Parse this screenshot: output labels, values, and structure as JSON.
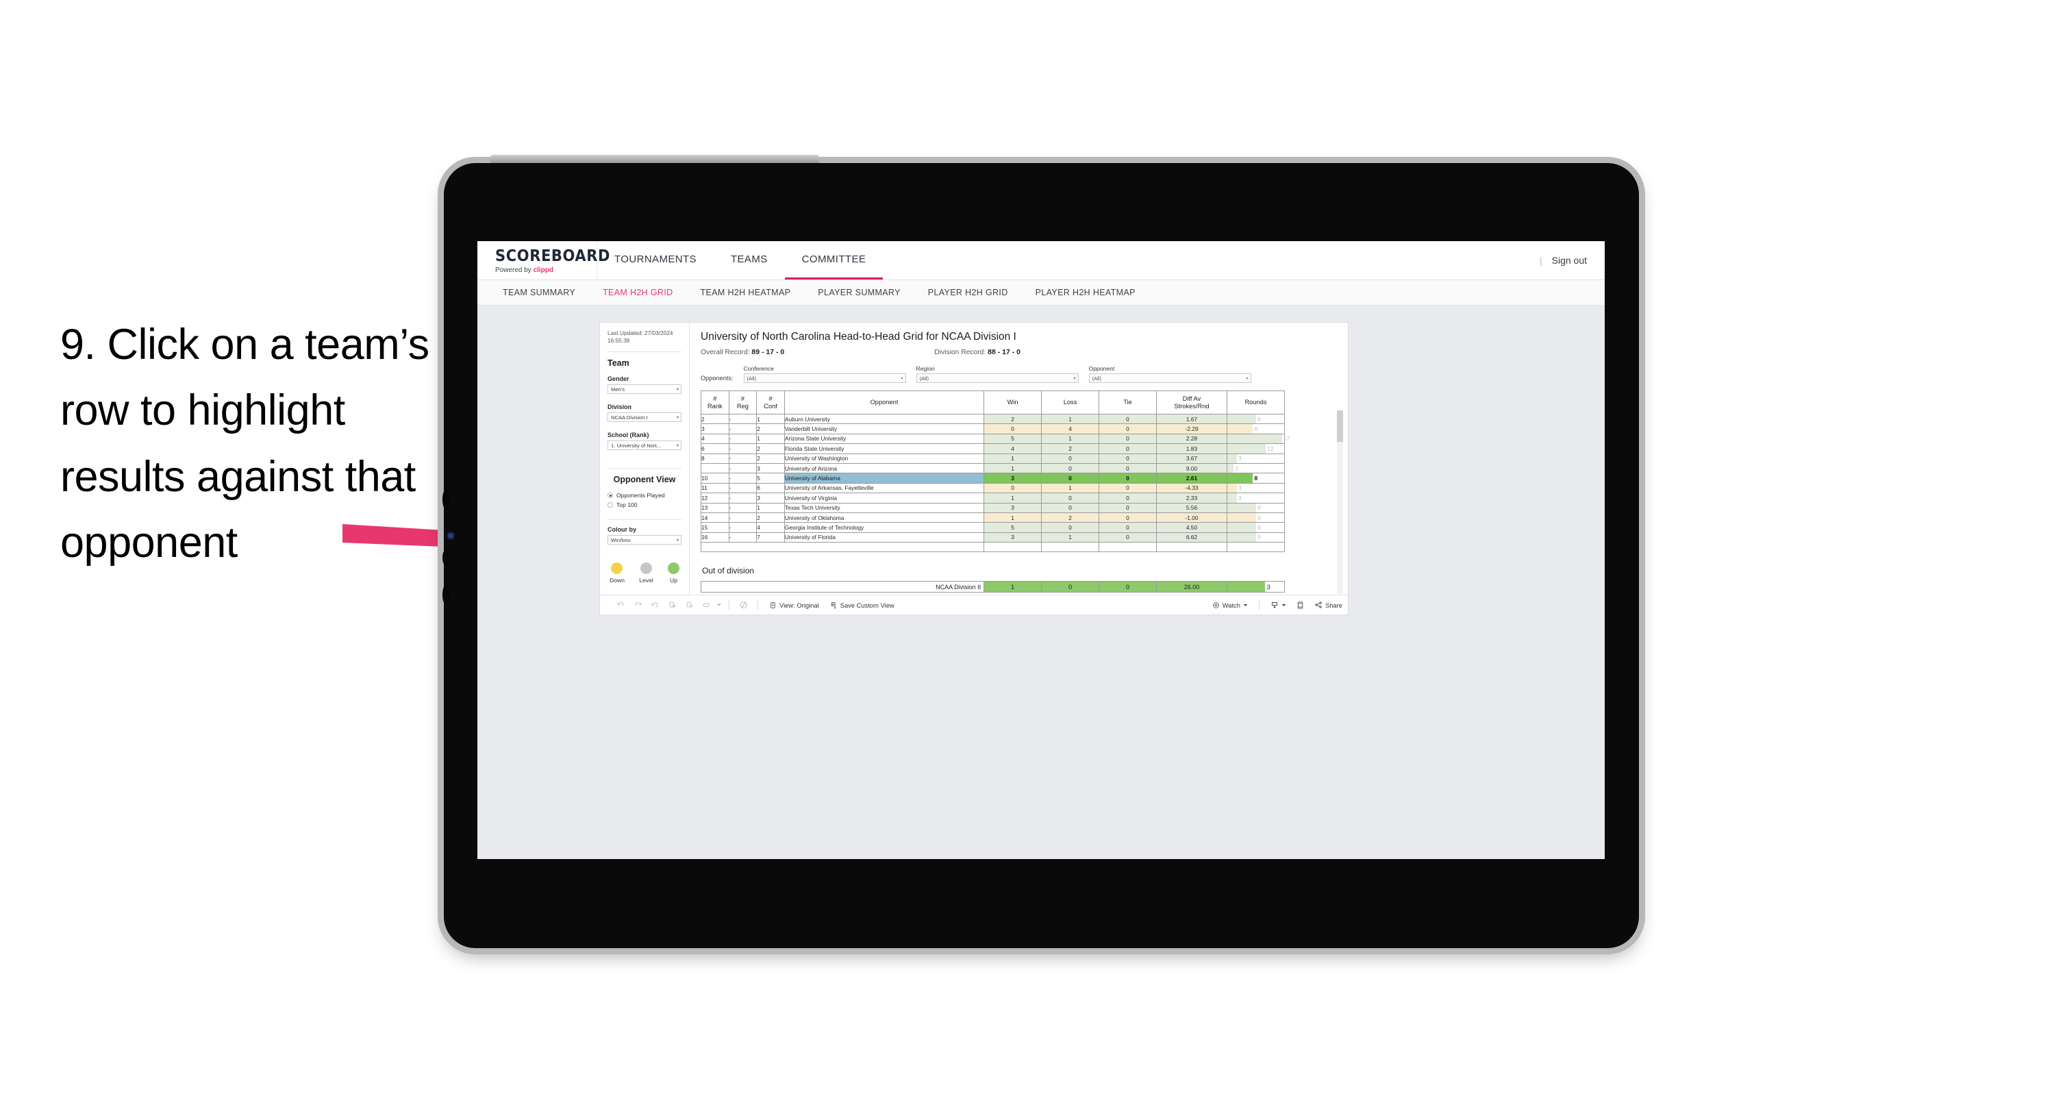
{
  "caption": "9. Click on a team’s row to highlight results against that opponent",
  "accent": "#e8376f",
  "header": {
    "logo_title": "SCOREBOARD",
    "logo_sub_prefix": "Powered by ",
    "logo_sub_brand": "clippd",
    "tabs": [
      {
        "label": "TOURNAMENTS",
        "active": false
      },
      {
        "label": "TEAMS",
        "active": false
      },
      {
        "label": "COMMITTEE",
        "active": true
      }
    ],
    "separator": "|",
    "sign_out": "Sign out"
  },
  "subnav": {
    "tabs": [
      {
        "label": "TEAM SUMMARY",
        "active": false
      },
      {
        "label": "TEAM H2H GRID",
        "active": true
      },
      {
        "label": "TEAM H2H HEATMAP",
        "active": false
      },
      {
        "label": "PLAYER SUMMARY",
        "active": false
      },
      {
        "label": "PLAYER H2H GRID",
        "active": false
      },
      {
        "label": "PLAYER H2H HEATMAP",
        "active": false
      }
    ]
  },
  "sidebar": {
    "last_updated": "Last Updated: 27/03/2024 16:55:38",
    "team_heading": "Team",
    "gender_label": "Gender",
    "gender_value": "Men’s",
    "division_label": "Division",
    "division_value": "NCAA Division I",
    "school_label": "School (Rank)",
    "school_value": "1. University of Nort...",
    "opponent_view_heading": "Opponent View",
    "radio_options": [
      {
        "label": "Opponents Played",
        "selected": true
      },
      {
        "label": "Top 100",
        "selected": false
      }
    ],
    "colour_by_label": "Colour by",
    "colour_by_value": "Win/loss",
    "legend": [
      {
        "label": "Down",
        "color": "#f2d24b"
      },
      {
        "label": "Level",
        "color": "#c6c6c9"
      },
      {
        "label": "Up",
        "color": "#8ec96a"
      }
    ]
  },
  "main": {
    "title": "University of North Carolina Head-to-Head Grid for NCAA Division I",
    "overall_record_label": "Overall Record: ",
    "overall_record_value": "89 - 17 - 0",
    "division_record_label": "Division Record: ",
    "division_record_value": "88 - 17 - 0",
    "filters_lead": "Opponents:",
    "filters": [
      {
        "label": "Conference",
        "value": "(All)"
      },
      {
        "label": "Region",
        "value": "(All)"
      },
      {
        "label": "Opponent",
        "value": "(All)"
      }
    ],
    "out_of_division_title": "Out of division",
    "out_of_division_row": {
      "label": "NCAA Division II",
      "win": "1",
      "loss": "0",
      "tie": "0",
      "diff": "26.00",
      "rounds": "3"
    }
  },
  "chart_data": {
    "type": "table",
    "title": "University of North Carolina Head-to-Head Grid for NCAA Division I",
    "columns": [
      "# Rank",
      "# Reg",
      "# Conf",
      "Opponent",
      "Win",
      "Loss",
      "Tie",
      "Diff Av Strokes/Rnd",
      "Rounds"
    ],
    "column_header_lines": [
      [
        "#",
        "Rank"
      ],
      [
        "#",
        "Reg"
      ],
      [
        "#",
        "Conf"
      ],
      [
        "Opponent"
      ],
      [
        "Win"
      ],
      [
        "Loss"
      ],
      [
        "Tie"
      ],
      [
        "Diff Av",
        "Strokes/Rnd"
      ],
      [
        "Rounds"
      ]
    ],
    "rows": [
      {
        "rank": "2",
        "reg": "-",
        "conf": "1",
        "opponent": "Auburn University",
        "win": "2",
        "loss": "1",
        "tie": "0",
        "diff": "1.67",
        "rounds": "9",
        "tone": "up",
        "selected": false
      },
      {
        "rank": "3",
        "reg": "-",
        "conf": "2",
        "opponent": "Vanderbilt University",
        "win": "0",
        "loss": "4",
        "tie": "0",
        "diff": "-2.29",
        "rounds": "8",
        "tone": "down",
        "selected": false
      },
      {
        "rank": "4",
        "reg": "-",
        "conf": "1",
        "opponent": "Arizona State University",
        "win": "5",
        "loss": "1",
        "tie": "0",
        "diff": "2.28",
        "rounds": "17",
        "tone": "up",
        "selected": false
      },
      {
        "rank": "6",
        "reg": "-",
        "conf": "2",
        "opponent": "Florida State University",
        "win": "4",
        "loss": "2",
        "tie": "0",
        "diff": "1.83",
        "rounds": "12",
        "tone": "up",
        "selected": false
      },
      {
        "rank": "8",
        "reg": "-",
        "conf": "2",
        "opponent": "University of Washington",
        "win": "1",
        "loss": "0",
        "tie": "0",
        "diff": "3.67",
        "rounds": "3",
        "tone": "up",
        "selected": false
      },
      {
        "rank": "",
        "reg": "-",
        "conf": "3",
        "opponent": "University of Arizona",
        "win": "1",
        "loss": "0",
        "tie": "0",
        "diff": "9.00",
        "rounds": "2",
        "tone": "up",
        "selected": false
      },
      {
        "rank": "10",
        "reg": "-",
        "conf": "5",
        "opponent": "University of Alabama",
        "win": "3",
        "loss": "0",
        "tie": "0",
        "diff": "2.61",
        "rounds": "8",
        "tone": "up",
        "selected": true
      },
      {
        "rank": "11",
        "reg": "-",
        "conf": "6",
        "opponent": "University of Arkansas, Fayetteville",
        "win": "0",
        "loss": "1",
        "tie": "0",
        "diff": "-4.33",
        "rounds": "3",
        "tone": "down",
        "selected": false
      },
      {
        "rank": "12",
        "reg": "-",
        "conf": "3",
        "opponent": "University of Virginia",
        "win": "1",
        "loss": "0",
        "tie": "0",
        "diff": "2.33",
        "rounds": "3",
        "tone": "up",
        "selected": false
      },
      {
        "rank": "13",
        "reg": "-",
        "conf": "1",
        "opponent": "Texas Tech University",
        "win": "3",
        "loss": "0",
        "tie": "0",
        "diff": "5.56",
        "rounds": "9",
        "tone": "up",
        "selected": false
      },
      {
        "rank": "14",
        "reg": "-",
        "conf": "2",
        "opponent": "University of Oklahoma",
        "win": "1",
        "loss": "2",
        "tie": "0",
        "diff": "-1.00",
        "rounds": "9",
        "tone": "down",
        "selected": false
      },
      {
        "rank": "15",
        "reg": "-",
        "conf": "4",
        "opponent": "Georgia Institute of Technology",
        "win": "5",
        "loss": "0",
        "tie": "0",
        "diff": "4.50",
        "rounds": "9",
        "tone": "up",
        "selected": false
      },
      {
        "rank": "16",
        "reg": "-",
        "conf": "7",
        "opponent": "University of Florida",
        "win": "3",
        "loss": "1",
        "tie": "0",
        "diff": "6.62",
        "rounds": "9",
        "tone": "up",
        "selected": false
      }
    ],
    "out_of_division": [
      {
        "label": "NCAA Division II",
        "win": "1",
        "loss": "0",
        "tie": "0",
        "diff": "26.00",
        "rounds": "3"
      }
    ],
    "colors": {
      "up": "#e3ebdc",
      "down": "#f7ecd0",
      "selected_row": "#7fc55b",
      "selected_opponent": "#91bed4"
    }
  },
  "toolbar": {
    "view_label": "View: Original",
    "save_label": "Save Custom View",
    "watch_label": "Watch",
    "share_label": "Share"
  }
}
